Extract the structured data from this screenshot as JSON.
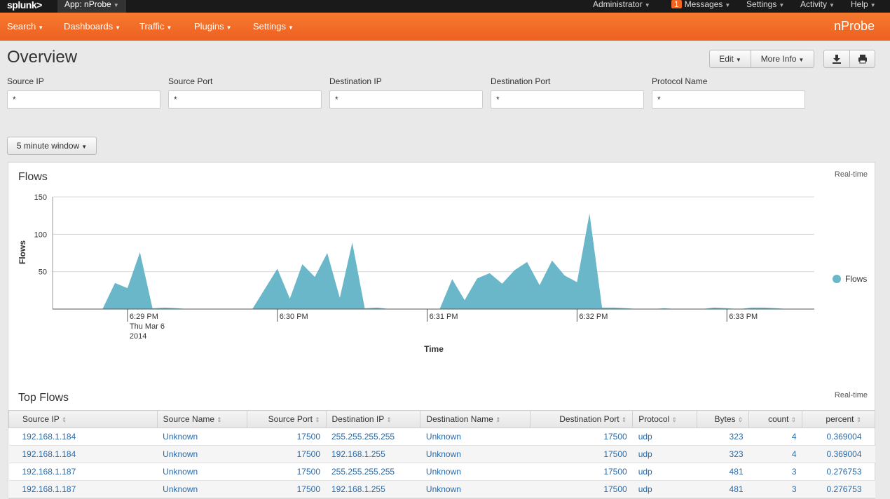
{
  "topbar": {
    "logo": "splunk>",
    "app_menu": "App: nProbe",
    "admin": "Administrator",
    "messages_count": "1",
    "messages": "Messages",
    "settings": "Settings",
    "activity": "Activity",
    "help": "Help"
  },
  "nav": {
    "items": [
      "Search",
      "Dashboards",
      "Traffic",
      "Plugins",
      "Settings"
    ],
    "app_name": "nProbe"
  },
  "header": {
    "title": "Overview",
    "edit": "Edit",
    "more_info": "More Info",
    "download_icon": "download-icon",
    "print_icon": "print-icon"
  },
  "filters": [
    {
      "label": "Source IP",
      "value": "*"
    },
    {
      "label": "Source Port",
      "value": "*"
    },
    {
      "label": "Destination IP",
      "value": "*"
    },
    {
      "label": "Destination Port",
      "value": "*"
    },
    {
      "label": "Protocol Name",
      "value": "*"
    }
  ],
  "time_window": "5 minute window",
  "flows_panel": {
    "title": "Flows",
    "realtime": "Real-time"
  },
  "chart_data": {
    "type": "area",
    "title": "Flows",
    "xlabel": "Time",
    "ylabel": "Flows",
    "ylim": [
      0,
      150
    ],
    "yticks": [
      "150",
      "100",
      "50"
    ],
    "xticks": [
      {
        "label": "6:29 PM",
        "sub1": "Thu Mar 6",
        "sub2": "2014",
        "t": 6
      },
      {
        "label": "6:30 PM",
        "sub1": "",
        "sub2": "",
        "t": 18
      },
      {
        "label": "6:31 PM",
        "sub1": "",
        "sub2": "",
        "t": 30
      },
      {
        "label": "6:32 PM",
        "sub1": "",
        "sub2": "",
        "t": 42
      },
      {
        "label": "6:33 PM",
        "sub1": "",
        "sub2": "",
        "t": 54
      }
    ],
    "legend": "right",
    "grid": true,
    "series": [
      {
        "name": "Flows",
        "color": "#6ab7c9",
        "x": [
          0,
          1,
          2,
          3,
          4,
          5,
          6,
          7,
          8,
          9,
          10,
          11,
          12,
          13,
          14,
          15,
          16,
          17,
          18,
          19,
          20,
          21,
          22,
          23,
          24,
          25,
          26,
          27,
          28,
          29,
          30,
          31,
          32,
          33,
          34,
          35,
          36,
          37,
          38,
          39,
          40,
          41,
          42,
          43,
          44,
          45,
          46,
          47,
          48,
          49,
          50,
          51,
          52,
          53,
          54,
          55,
          56,
          57,
          58,
          59,
          60,
          61
        ],
        "values": [
          0,
          0,
          0,
          0,
          0,
          35,
          28,
          76,
          1,
          2,
          1,
          0,
          0,
          0,
          0,
          0,
          0,
          27,
          54,
          14,
          60,
          43,
          75,
          15,
          89,
          1,
          2,
          0,
          0,
          0,
          0,
          0,
          40,
          12,
          41,
          48,
          34,
          52,
          63,
          32,
          65,
          45,
          36,
          128,
          2,
          2,
          1,
          0,
          0,
          1,
          0,
          0,
          0,
          2,
          1,
          0,
          2,
          2,
          1,
          0,
          0,
          0
        ]
      }
    ]
  },
  "table_panel": {
    "title": "Top Flows",
    "realtime": "Real-time",
    "columns": [
      "Source IP",
      "Source Name",
      "Source Port",
      "Destination IP",
      "Destination Name",
      "Destination Port",
      "Protocol",
      "Bytes",
      "count",
      "percent"
    ],
    "rows": [
      [
        "192.168.1.184",
        "Unknown",
        "17500",
        "255.255.255.255",
        "Unknown",
        "17500",
        "udp",
        "323",
        "4",
        "0.369004"
      ],
      [
        "192.168.1.184",
        "Unknown",
        "17500",
        "192.168.1.255",
        "Unknown",
        "17500",
        "udp",
        "323",
        "4",
        "0.369004"
      ],
      [
        "192.168.1.187",
        "Unknown",
        "17500",
        "255.255.255.255",
        "Unknown",
        "17500",
        "udp",
        "481",
        "3",
        "0.276753"
      ],
      [
        "192.168.1.187",
        "Unknown",
        "17500",
        "192.168.1.255",
        "Unknown",
        "17500",
        "udp",
        "481",
        "3",
        "0.276753"
      ]
    ]
  }
}
